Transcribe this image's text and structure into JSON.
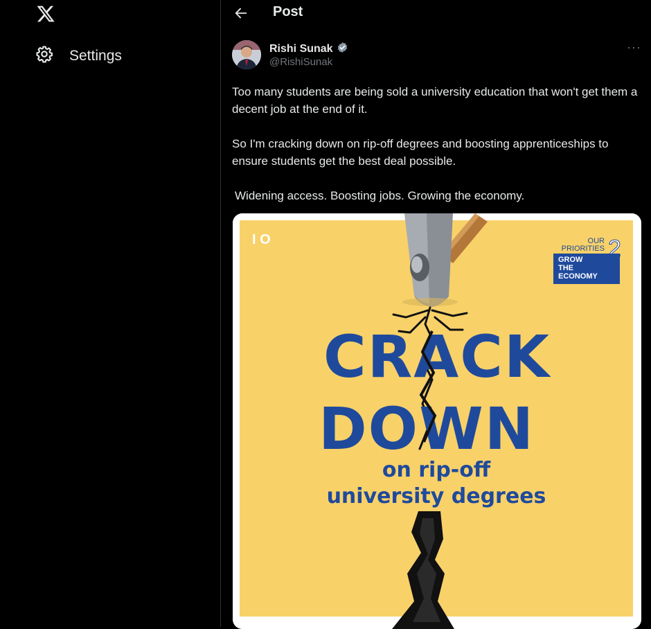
{
  "sidebar": {
    "logo_icon": "x-logo-icon",
    "settings_label": "Settings"
  },
  "header": {
    "title": "Post"
  },
  "post": {
    "author_name": "Rishi Sunak",
    "author_handle": "@RishiSunak",
    "verified": true,
    "more_icon": "···",
    "paragraphs": [
      "Too many students are being sold a university education that won't get them a decent job at the end of it.",
      "So I'm cracking down on rip-off degrees and boosting apprenticeships to ensure students get the best deal possible.",
      "Widening access. Boosting jobs. Growing the economy."
    ],
    "image": {
      "corner_mark": "I O",
      "badge_line1": "OUR",
      "badge_line2": "PRIORITIES",
      "badge_number": "2",
      "badge_box_line1": "GROW",
      "badge_box_line2": "THE",
      "badge_box_line3": "ECONOMY",
      "headline_line1": "CRACK",
      "headline_line2": "DOWN",
      "subline1": "on rip-off",
      "subline2": "university degrees"
    }
  },
  "colors": {
    "background": "#000000",
    "text": "#e7e9ea",
    "muted": "#71767b",
    "divider": "#2f3336",
    "poster_yellow": "#f8d169",
    "poster_blue": "#1f4a9c",
    "verified_blue": "#1d9bf0"
  }
}
